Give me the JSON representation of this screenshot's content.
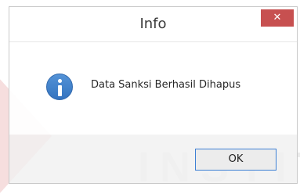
{
  "watermark": {
    "text": "INSTIT"
  },
  "dialog": {
    "title": "Info",
    "close_label": "✕",
    "message": "Data Sanksi Berhasil Dihapus",
    "icon": "info-icon",
    "ok_label": "OK"
  },
  "colors": {
    "close_button": "#c75050",
    "info_icon": "#3a7bc8",
    "ok_button_border": "#3c7fd4",
    "button_panel": "#f0f0f0"
  }
}
